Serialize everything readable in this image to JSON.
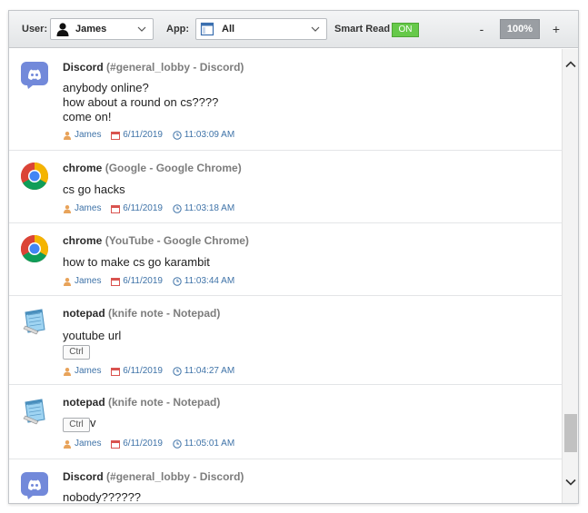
{
  "toolbar": {
    "user_label": "User:",
    "user_value": "James",
    "app_label": "App:",
    "app_value": "All",
    "smart_read_label": "Smart Read",
    "smart_read_state": "ON",
    "zoom_minus": "-",
    "zoom_value": "100%",
    "zoom_plus": "+"
  },
  "colors": {
    "toggle_on": "#66c94a",
    "meta_text": "#3f73a8",
    "discord": "#7289da",
    "zoom_bg": "#9a9ea3"
  },
  "entries": [
    {
      "icon": "discord-icon",
      "app": "Discord",
      "window": "(#general_lobby - Discord)",
      "lines": [
        "anybody online?",
        "how about a round on cs????",
        "come on!"
      ],
      "user": "James",
      "date": "6/11/2019",
      "time": "11:03:09 AM"
    },
    {
      "icon": "chrome-icon",
      "app": "chrome",
      "window": "(Google - Google Chrome)",
      "lines": [
        "cs go hacks"
      ],
      "user": "James",
      "date": "6/11/2019",
      "time": "11:03:18 AM"
    },
    {
      "icon": "chrome-icon",
      "app": "chrome",
      "window": "(YouTube - Google Chrome)",
      "lines": [
        "how to make cs go karambit"
      ],
      "user": "James",
      "date": "6/11/2019",
      "time": "11:03:44 AM"
    },
    {
      "icon": "notepad-icon",
      "app": "notepad",
      "window": "(knife note - Notepad)",
      "lines": [
        "youtube url"
      ],
      "key": "Ctrl",
      "user": "James",
      "date": "6/11/2019",
      "time": "11:04:27 AM"
    },
    {
      "icon": "notepad-icon",
      "app": "notepad",
      "window": "(knife note - Notepad)",
      "key": "Ctrl",
      "key_suffix": "v",
      "user": "James",
      "date": "6/11/2019",
      "time": "11:05:01 AM"
    },
    {
      "icon": "discord-icon",
      "app": "Discord",
      "window": "(#general_lobby - Discord)",
      "lines": [
        "nobody??????"
      ]
    }
  ]
}
